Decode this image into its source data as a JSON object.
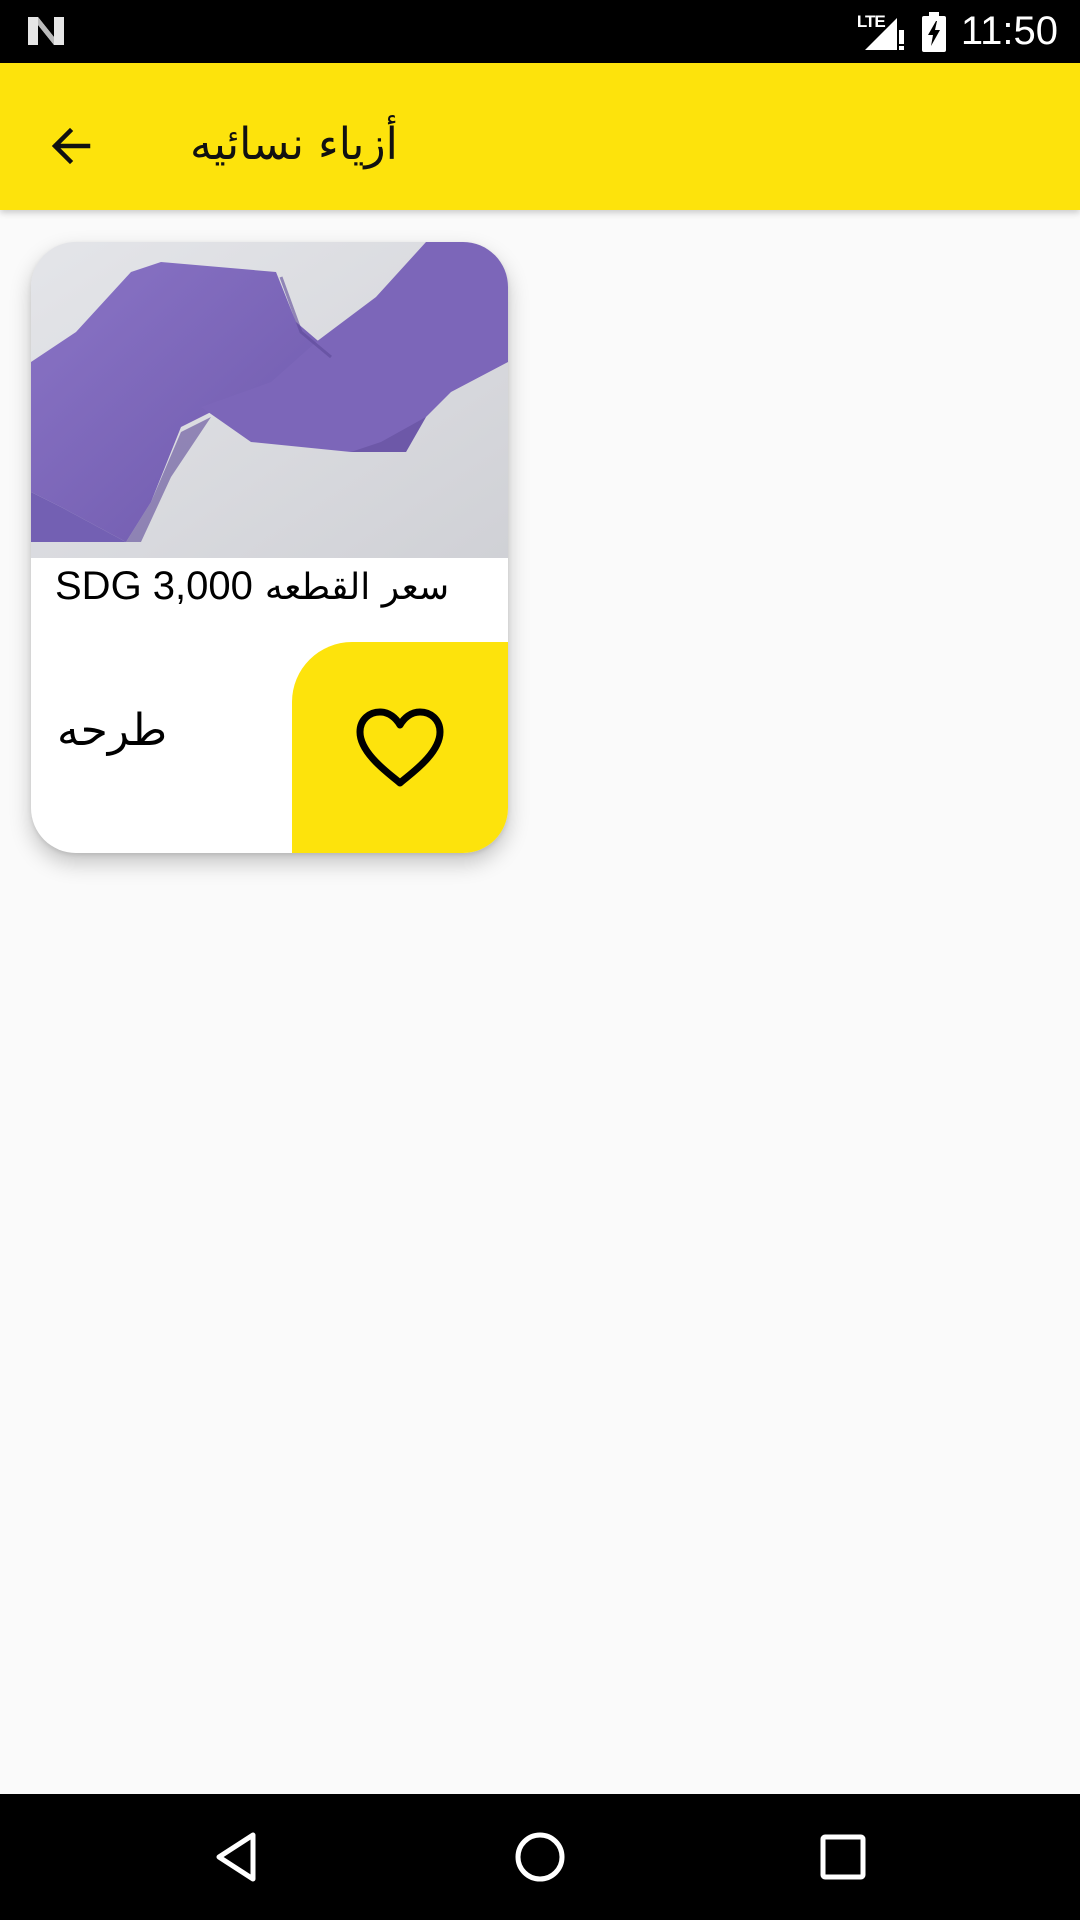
{
  "status_bar": {
    "network_label": "LTE",
    "time": "11:50",
    "icons": [
      "n-logo-icon",
      "lte-signal-icon",
      "battery-charging-icon"
    ]
  },
  "app_bar": {
    "title": "أزياء نسائيه",
    "back_icon": "arrow-back-icon",
    "background_color": "#fde30c"
  },
  "products": [
    {
      "image_desc_icon": "purple-scarf-image",
      "price_label": "سعر القطعه",
      "price_value": "SDG 3,000",
      "name": "طرحه",
      "favorite_icon": "heart-outline-icon",
      "accent_color": "#fde30c"
    }
  ],
  "nav_bar": {
    "back_icon": "triangle-back-icon",
    "home_icon": "circle-home-icon",
    "recents_icon": "square-recents-icon"
  }
}
